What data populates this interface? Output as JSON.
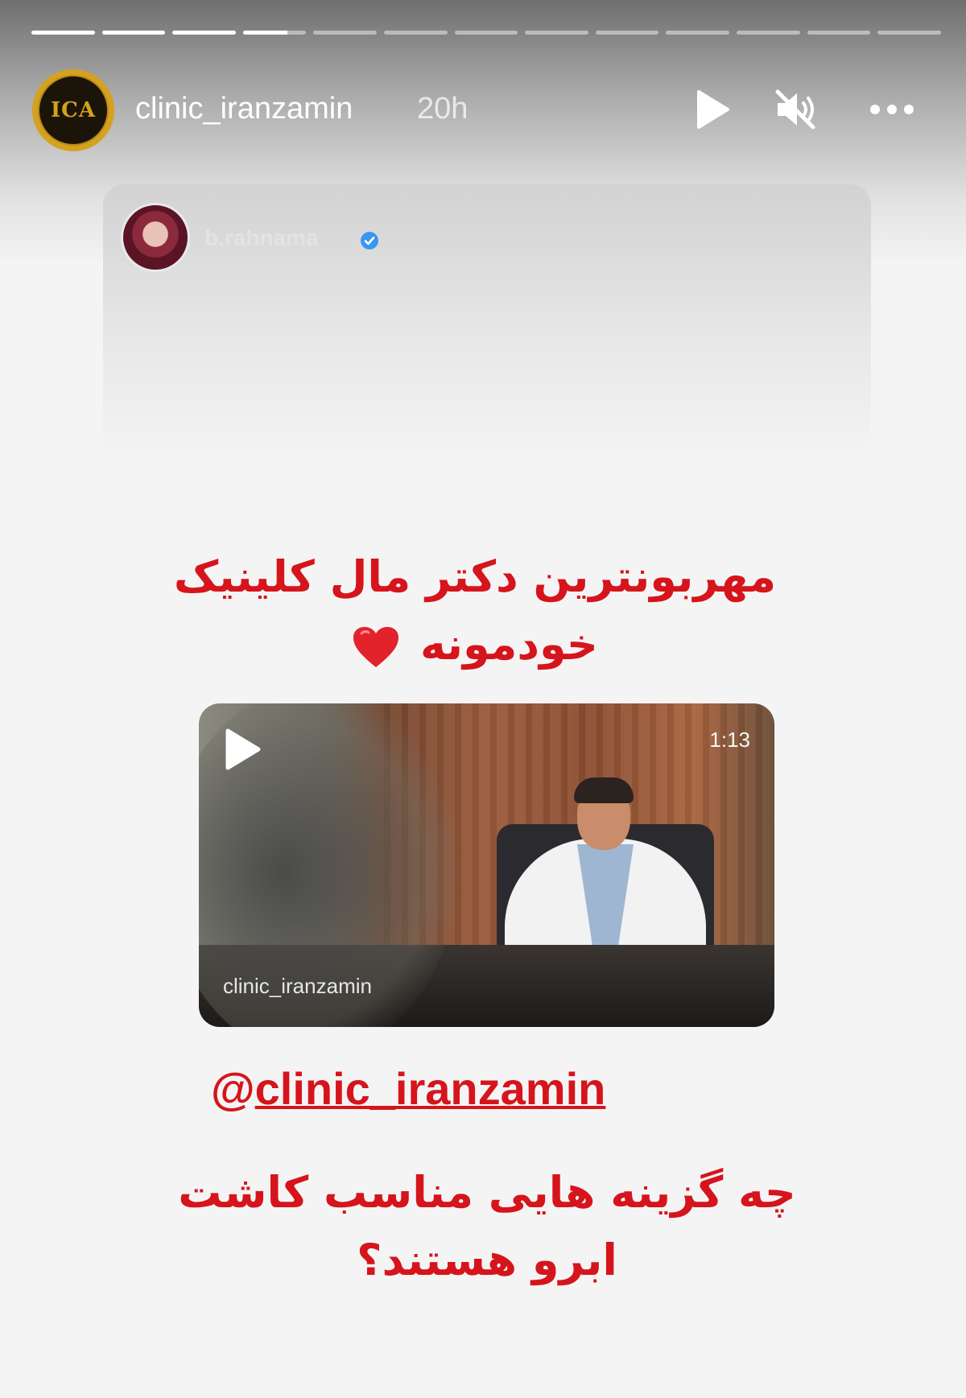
{
  "story": {
    "progress": {
      "segments": [
        1,
        1,
        1,
        0.7,
        0,
        0,
        0,
        0,
        0,
        0,
        0,
        0,
        0
      ]
    },
    "header": {
      "username": "clinic_iranzamin",
      "time": "20h",
      "avatar_icon": "clinic-logo-icon",
      "avatar_initials": "ICA"
    },
    "controls": {
      "play_icon": "play-icon",
      "mute_icon": "speaker-muted-icon",
      "more_icon": "more-horizontal-icon"
    }
  },
  "shared_post": {
    "username": "b.rahnama",
    "verified_icon": "verified-badge-icon",
    "caption_line1": "مهربونترین دکتر مال کلینیک",
    "caption_line2": "خودمونه",
    "caption_emoji_icon": "red-heart-icon",
    "video": {
      "duration": "1:13",
      "watermark": "clinic_iranzamin",
      "play_icon": "play-icon"
    },
    "mention_at": "@",
    "mention_handle": "clinic_iranzamin",
    "question_line1": "چه گزینه هایی مناسب کاشت",
    "question_line2": "ابرو هستند؟"
  },
  "colors": {
    "accent_red": "#d6141c",
    "verified_blue": "#3897f0",
    "logo_gold": "#d4a21f"
  }
}
